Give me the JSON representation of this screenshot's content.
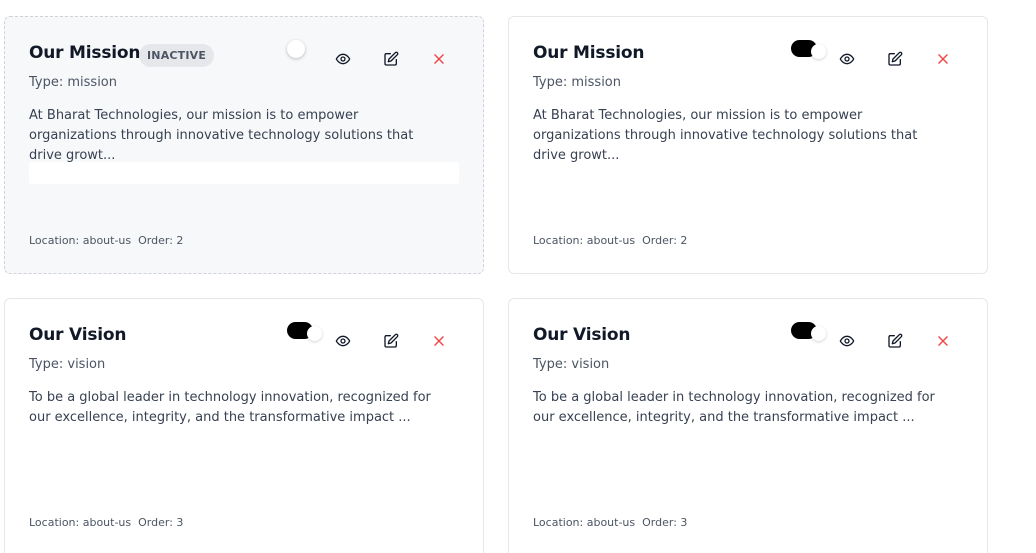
{
  "cards": [
    {
      "title": "Our Mission",
      "badge": "INACTIVE",
      "type_label": "Type: mission",
      "description": "At Bharat Technologies, our mission is to empower organizations through innovative technology solutions that drive growt...",
      "location_label": "Location: about-us",
      "order_label": "Order: 2",
      "active": false
    },
    {
      "title": "Our Mission",
      "type_label": "Type: mission",
      "description": "At Bharat Technologies, our mission is to empower organizations through innovative technology solutions that drive growt...",
      "location_label": "Location: about-us",
      "order_label": "Order: 2",
      "active": true
    },
    {
      "title": "Our Vision",
      "type_label": "Type: vision",
      "description": "To be a global leader in technology innovation, recognized for our excellence, integrity, and the transformative impact ...",
      "location_label": "Location: about-us",
      "order_label": "Order: 3",
      "active": true
    },
    {
      "title": "Our Vision",
      "type_label": "Type: vision",
      "description": "To be a global leader in technology innovation, recognized for our excellence, integrity, and the transformative impact ...",
      "location_label": "Location: about-us",
      "order_label": "Order: 3",
      "active": true
    }
  ],
  "icons": {
    "view": "eye-icon",
    "edit": "edit-icon",
    "delete": "close-icon"
  },
  "colors": {
    "delete_accent": "#ef4444",
    "toggle_on": "#000000",
    "inactive_card_bg": "#f7f8fa"
  }
}
